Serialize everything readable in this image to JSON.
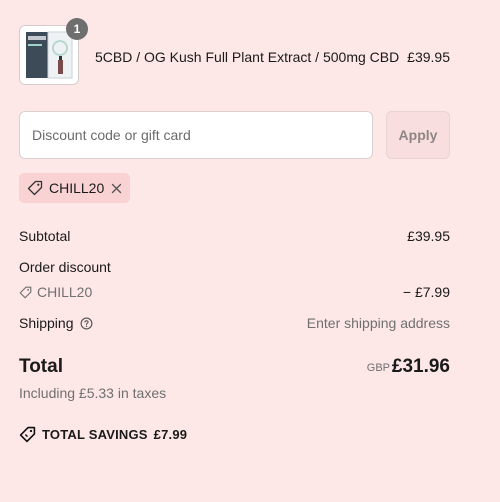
{
  "product": {
    "quantity": "1",
    "name": "5CBD / OG Kush Full Plant Extract / 500mg CBD",
    "price": "£39.95",
    "thumbnail_icon": "product-box-icon"
  },
  "discount": {
    "placeholder": "Discount code or gift card",
    "apply_label": "Apply",
    "applied_code": "CHILL20",
    "tag_icon": "tag-icon",
    "remove_icon": "close-icon"
  },
  "summary": {
    "subtotal_label": "Subtotal",
    "subtotal_value": "£39.95",
    "order_discount_label": "Order discount",
    "discount_code": "CHILL20",
    "discount_value": "− £7.99",
    "shipping_label": "Shipping",
    "shipping_value": "Enter shipping address",
    "total_label": "Total",
    "currency": "GBP",
    "total_value": "£31.96",
    "taxes_note": "Including £5.33 in taxes",
    "savings_label": "TOTAL SAVINGS",
    "savings_value": "£7.99"
  },
  "colors": {
    "background": "#fde7e7",
    "chip": "#f9d3d3",
    "muted": "#707070"
  }
}
